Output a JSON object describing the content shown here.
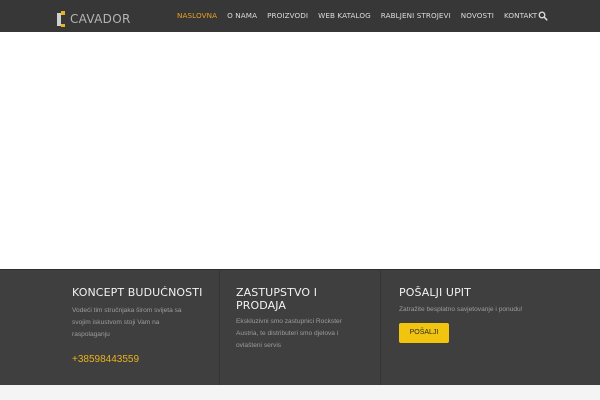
{
  "header": {
    "logo_text": "CAVADOR",
    "nav": [
      {
        "label": "NASLOVNA",
        "active": true
      },
      {
        "label": "O NAMA",
        "active": false
      },
      {
        "label": "PROIZVODI",
        "active": false
      },
      {
        "label": "WEB KATALOG",
        "active": false
      },
      {
        "label": "RABLJENI STROJEVI",
        "active": false
      },
      {
        "label": "NOVOSTI",
        "active": false
      },
      {
        "label": "KONTAKT",
        "active": false
      }
    ],
    "search_icon": "search-icon"
  },
  "footer": {
    "col1": {
      "title": "KONCEPT BUDUĆNOSTI",
      "text": "Vodeći tim stručnjaka širom svijeta sa svojim iskustvom stoji Vam na raspolaganju",
      "phone": "+38598443559"
    },
    "col2": {
      "title": "ZASTUPSTVO I PRODAJA",
      "text": "Ekskluzivni smo zastupnici Rockster Austria, te distributeri smo djelova i ovlašteni servis"
    },
    "col3": {
      "title": "POŠALJI UPIT",
      "text": "Zatražite besplatno savjetovanje i ponudu!",
      "button": "POŠALJI"
    }
  },
  "colors": {
    "header_bg": "#373737",
    "footer_bg": "#3f3f3f",
    "accent": "#e8a222",
    "button": "#f1c40f"
  }
}
